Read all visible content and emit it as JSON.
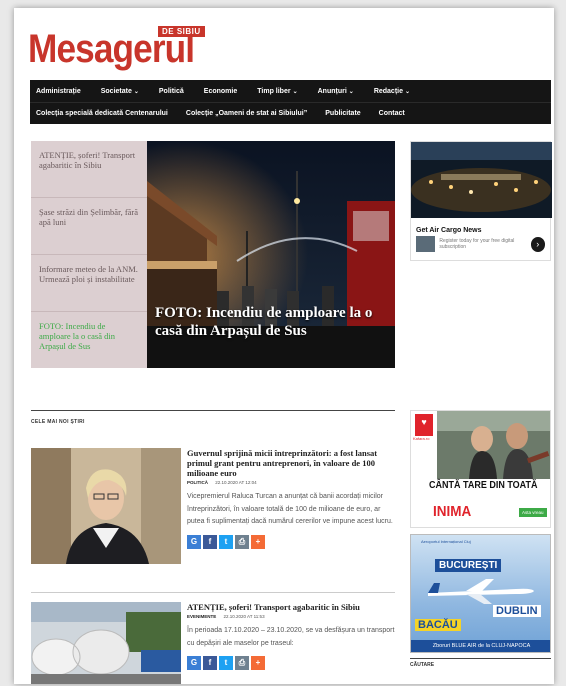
{
  "logo": {
    "name": "Mesagerul",
    "sub": "DE SIBIU"
  },
  "nav": {
    "row1": [
      {
        "label": "Administrație",
        "dropdown": false
      },
      {
        "label": "Societate",
        "dropdown": true
      },
      {
        "label": "Politică",
        "dropdown": false
      },
      {
        "label": "Economie",
        "dropdown": false
      },
      {
        "label": "Timp liber",
        "dropdown": true
      },
      {
        "label": "Anunțuri",
        "dropdown": true
      },
      {
        "label": "Redacție",
        "dropdown": true
      }
    ],
    "row2": [
      {
        "label": "Colecția specială dedicată Centenarului"
      },
      {
        "label": "Colecție „Oameni de stat ai Sibiului”"
      },
      {
        "label": "Publicitate"
      },
      {
        "label": "Contact"
      }
    ]
  },
  "hero_list": [
    {
      "title": "ATENȚIE, șoferi! Transport agabaritic în Sibiu"
    },
    {
      "title": "Șase străzi din Șelimbăr, fără apă luni"
    },
    {
      "title": "Informare meteo de la ANM. Urmează ploi și instabilitate"
    },
    {
      "title": "FOTO: Incendiu de amploare la o casă din Arpașul de Sus"
    }
  ],
  "hero": {
    "caption": "FOTO: Incendiu de amploare la o casă din Arpașul de Sus"
  },
  "ad1": {
    "title": "Get Air Cargo News",
    "text": "Register today for your free digital subscription",
    "button": "›"
  },
  "section": {
    "title": "CELE MAI NOI ȘTIRI"
  },
  "articles": [
    {
      "title": "Guvernul sprijină micii întreprinzători: a fost lansat primul grant pentru antreprenori, în valoare de 100 milioane euro",
      "category": "POLITICĂ",
      "date": "22.10.2020 AT 12:04",
      "excerpt": "Vicepremierul Raluca Turcan a anunțat că banii acordați micilor întreprinzători, în valoare totală de 100 de milioane de euro, ar putea fi suplimentați dacă numărul cererilor ve impune acest lucru."
    },
    {
      "title": "ATENȚIE, șoferi! Transport agabaritic în Sibiu",
      "category": "EVENIMENTE",
      "date": "22.10.2020 AT 11:53",
      "excerpt": "În perioada 17.10.2020 – 23.10.2020, se va desfășura un transport cu depășiri ale maselor pe traseul:"
    }
  ],
  "share_buttons": [
    {
      "icon": "google-plus-icon",
      "glyph": "G"
    },
    {
      "icon": "facebook-icon",
      "glyph": "f"
    },
    {
      "icon": "twitter-icon",
      "glyph": "t"
    },
    {
      "icon": "print-icon",
      "glyph": "⎙"
    },
    {
      "icon": "more-share-icon",
      "glyph": "+"
    }
  ],
  "ad2": {
    "brand": "kiss",
    "brand_sub": "Kafara.ro",
    "heading1": "CÂNTĂ TARE DIN TOATĂ",
    "heading2": "INIMA",
    "button": "Asta vreau"
  },
  "ad3": {
    "top": "Aeroportul Internațional Cluj",
    "city1": "BUCUREȘTI",
    "city2": "DUBLIN",
    "city3": "BACĂU",
    "footer": "Zboruri BLUE AIR de la CLUJ-NAPOCA"
  },
  "sidebar": {
    "search_title": "CĂUTARE"
  },
  "colors": {
    "brand_red": "#c8352b",
    "nav_bg": "#151515",
    "active_green": "#3daa47",
    "list_bg": "#dccfd1"
  }
}
